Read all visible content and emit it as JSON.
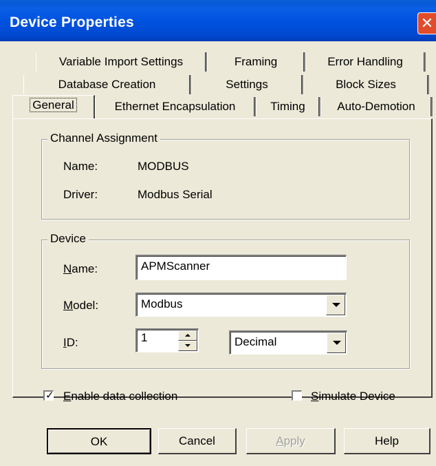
{
  "window": {
    "title": "Device Properties",
    "close_glyph": "✕"
  },
  "tabs": {
    "row1": [
      "Variable Import Settings",
      "Framing",
      "Error Handling"
    ],
    "row2": [
      "Database Creation",
      "Settings",
      "Block Sizes"
    ],
    "row3": [
      "General",
      "Ethernet Encapsulation",
      "Timing",
      "Auto-Demotion"
    ],
    "selected": "General"
  },
  "channel": {
    "legend": "Channel Assignment",
    "name_label": "Name:",
    "name_value": "MODBUS",
    "driver_label": "Driver:",
    "driver_value": "Modbus Serial"
  },
  "device": {
    "legend": "Device",
    "name_label_u": "N",
    "name_label_rest": "ame:",
    "name_value": "APMScanner",
    "model_label_u": "M",
    "model_label_rest": "odel:",
    "model_value": "Modbus",
    "id_label_u": "I",
    "id_label_rest": "D:",
    "id_value": "1",
    "id_format": "Decimal"
  },
  "options": {
    "enable_u": "E",
    "enable_rest": "nable data collection",
    "enable_checked": true,
    "check_glyph": "✓",
    "simulate_u": "S",
    "simulate_rest": "imulate Device",
    "simulate_checked": false
  },
  "buttons": {
    "ok": "OK",
    "cancel": "Cancel",
    "apply_u": "A",
    "apply_rest": "pply",
    "help": "Help"
  }
}
